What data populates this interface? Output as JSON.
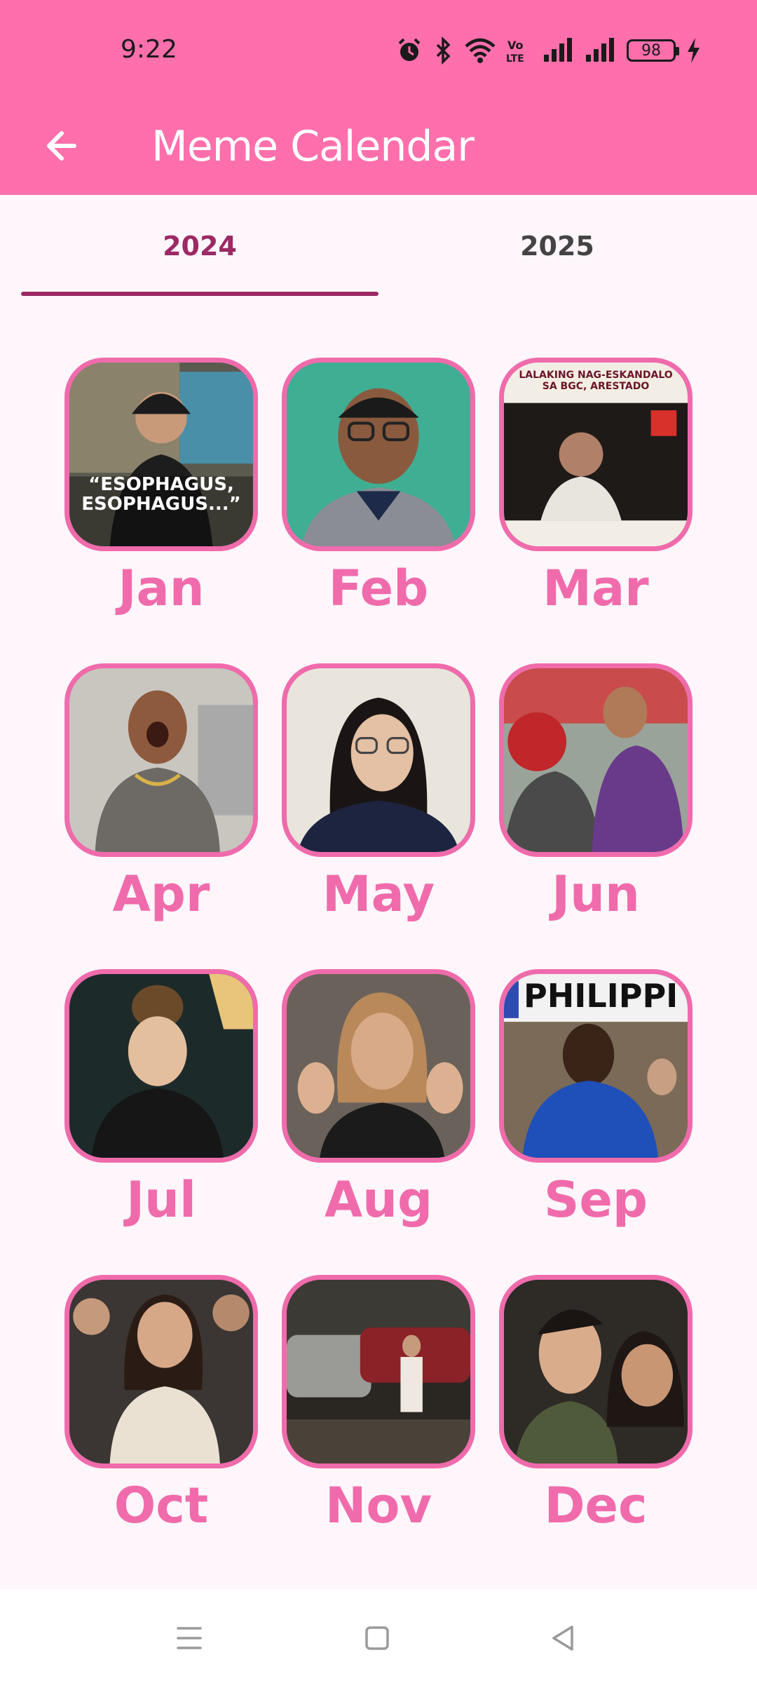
{
  "status_bar": {
    "time": "9:22",
    "battery": "98",
    "network_label": "Vo LTE"
  },
  "app_bar": {
    "title": "Meme Calendar",
    "back_icon": "arrow-left-icon",
    "color": "#FF6FAC"
  },
  "tabs": [
    {
      "label": "2024",
      "selected": true
    },
    {
      "label": "2025",
      "selected": false
    }
  ],
  "months": [
    {
      "label": "Jan",
      "caption": "“ESOPHAGUS,\nESOPHAGUS...”"
    },
    {
      "label": "Feb"
    },
    {
      "label": "Mar",
      "caption": "LALAKING NAG-ESKANDALO\nSA BGC, ARESTADO"
    },
    {
      "label": "Apr"
    },
    {
      "label": "May"
    },
    {
      "label": "Jun"
    },
    {
      "label": "Jul"
    },
    {
      "label": "Aug"
    },
    {
      "label": "Sep",
      "caption": "PHILIPPI"
    },
    {
      "label": "Oct"
    },
    {
      "label": "Nov"
    },
    {
      "label": "Dec"
    }
  ],
  "colors": {
    "accent": "#F06BAC",
    "tab_active": "#9B2A66",
    "background": "#FEF6FA"
  },
  "nav_bar": {
    "icons": [
      "menu-icon",
      "home-square-icon",
      "back-triangle-icon"
    ]
  }
}
